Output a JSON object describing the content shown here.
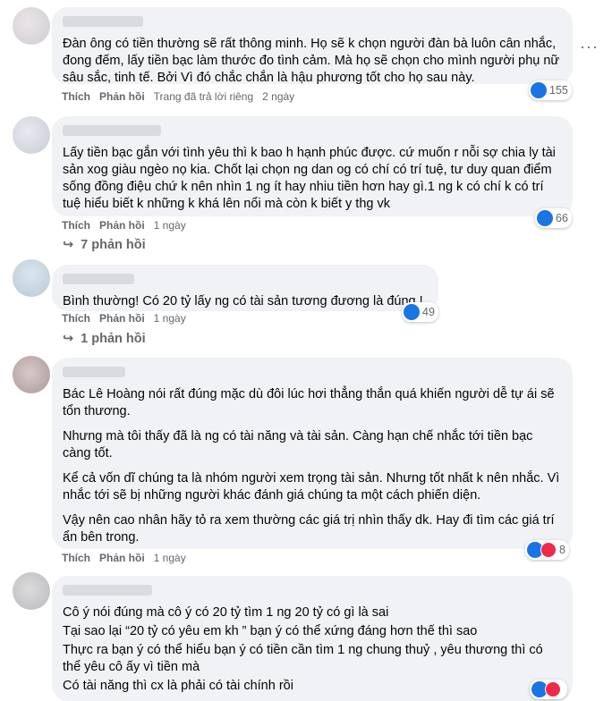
{
  "comments": [
    {
      "paragraphs": [
        "Đàn ông có tiền thường sẽ rất thông minh. Họ sẽ k chọn người đàn bà luôn cân nhắc, đong đếm, lấy tiền bạc làm thước đo tình cảm. Mà họ sẽ chọn cho mình người phụ nữ sâu sắc, tinh tế. Bởi Vì đó chắc chắn là hậu phương tốt cho họ sau này."
      ],
      "like_label": "Thích",
      "reply_label": "Phản hồi",
      "extra": "Trang đã trả lời riêng",
      "time": "2 ngày",
      "reaction_count": "155"
    },
    {
      "paragraphs": [
        "Lấy tiền bạc gắn với tình yêu thì k bao h hạnh phúc được. cứ muốn r nỗi sợ chia ly tài sản xog giàu ngèo nọ kia. Chốt lại chọn ng dan og có chí có trí tuệ, tư duy quan điểm sống đồng điệu chứ k nên nhìn 1 ng ít hay nhiu tiền hơn hay gì.1 ng k có chí k có trí tuệ hiểu biết k những k khá lên nổi mà còn k biết y thg vk"
      ],
      "like_label": "Thích",
      "reply_label": "Phản hồi",
      "time": "1 ngày",
      "reaction_count": "66",
      "replies_label": "7 phản hồi"
    },
    {
      "paragraphs": [
        "Bình thường! Có 20 tỷ lấy ng có tài sản tương đương là đúng !"
      ],
      "like_label": "Thích",
      "reply_label": "Phản hồi",
      "time": "1 ngày",
      "reaction_count": "49",
      "replies_label": "1 phản hồi"
    },
    {
      "paragraphs": [
        "Bác Lê Hoàng nói rất đúng mặc dù đôi lúc hơi thẳng thắn quá khiến người dễ tự ái sẽ tổn thương.",
        "Nhưng mà tôi thấy đã là ng có tài năng và tài sản. Càng hạn chế nhắc tới tiền bạc càng tốt.",
        "Kể cả vốn dĩ chúng ta là nhóm người xem trọng tài sản. Nhưng tốt nhất k nên nhắc. Vì nhắc tới sẽ bị những người khác đánh giá chúng ta một cách phiến diện.",
        "Vậy nên cao nhân hãy tỏ ra xem thường các giá trị nhìn thấy dk. Hay đi tìm các giá trí ẩn bên trong."
      ],
      "like_label": "Thích",
      "reply_label": "Phản hồi",
      "time": "1 ngày",
      "reaction_count": "8"
    },
    {
      "paragraphs": [
        "Cô ý nói đúng mà cô ý có 20 tỷ tìm 1 ng 20 tỷ có gì là sai",
        "Tại sao lại “20 tỷ có yêu em kh ” bạn ý có thể xứng đáng hơn thế thì sao",
        "Thực ra bạn ý có thể hiểu bạn ý có tiền cần tìm 1 ng chung thuỷ , yêu thương thì có thể yêu cô ấy vì tiền mà",
        "Có tài năng thì cx là phải có tài chính rồi"
      ]
    }
  ],
  "colors": {
    "like": "#1b74e4",
    "heart": "#f02849",
    "bubble": "#f0f2f5",
    "meta": "#65676b"
  }
}
